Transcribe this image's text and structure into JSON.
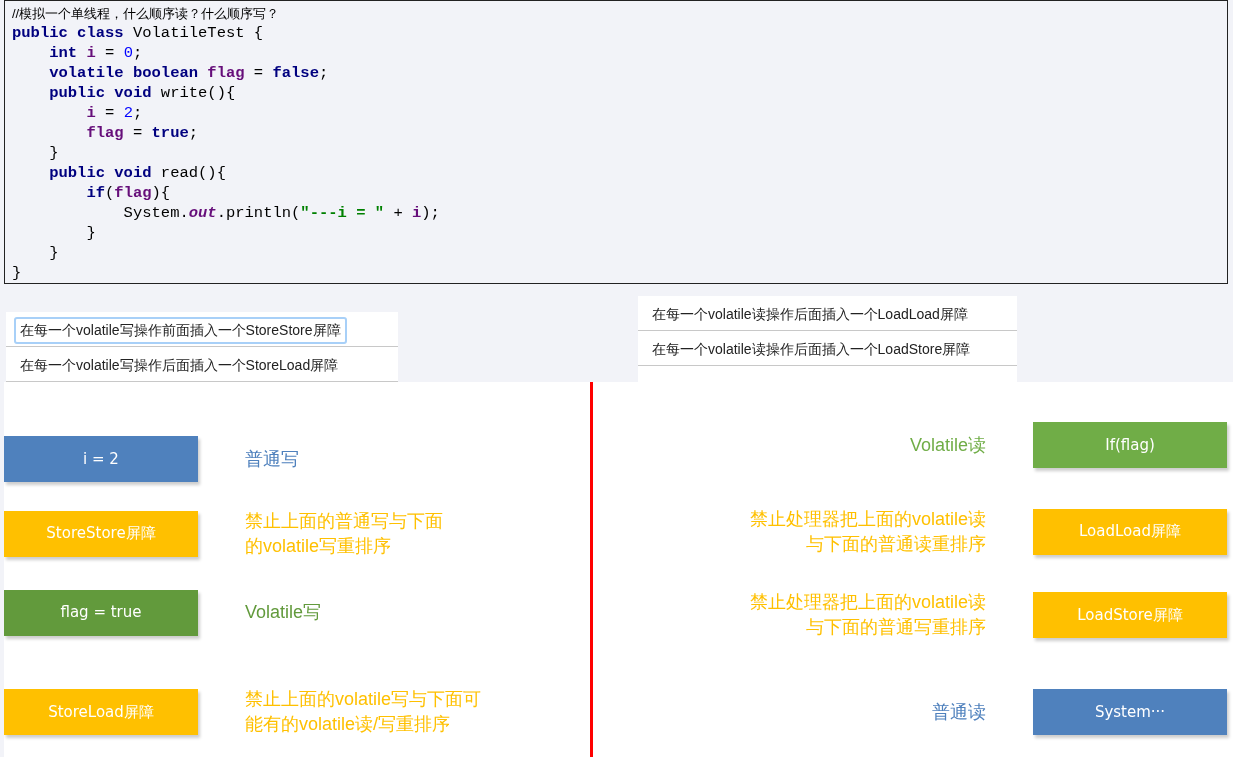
{
  "code": {
    "comment": "//模拟一个单线程，什么顺序读？什么顺序写？",
    "lines": [
      [
        {
          "kind": "keyword",
          "text": "public class"
        },
        {
          "kind": "plain",
          "text": " VolatileTest {"
        }
      ],
      [
        {
          "kind": "keyword",
          "text": "    int"
        },
        {
          "kind": "field",
          "text": " i"
        },
        {
          "kind": "plain",
          "text": " = "
        },
        {
          "kind": "number",
          "text": "0"
        },
        {
          "kind": "plain",
          "text": ";"
        }
      ],
      [
        {
          "kind": "keyword",
          "text": "    volatile boolean"
        },
        {
          "kind": "field",
          "text": " flag"
        },
        {
          "kind": "plain",
          "text": " = "
        },
        {
          "kind": "keyword",
          "text": "false"
        },
        {
          "kind": "plain",
          "text": ";"
        }
      ],
      [
        {
          "kind": "keyword",
          "text": "    public void"
        },
        {
          "kind": "plain",
          "text": " write(){"
        }
      ],
      [
        {
          "kind": "field",
          "text": "        i"
        },
        {
          "kind": "plain",
          "text": " = "
        },
        {
          "kind": "number",
          "text": "2"
        },
        {
          "kind": "plain",
          "text": ";"
        }
      ],
      [
        {
          "kind": "field",
          "text": "        flag"
        },
        {
          "kind": "plain",
          "text": " = "
        },
        {
          "kind": "keyword",
          "text": "true"
        },
        {
          "kind": "plain",
          "text": ";"
        }
      ],
      [
        {
          "kind": "plain",
          "text": "    }"
        }
      ],
      [
        {
          "kind": "keyword",
          "text": "    public void"
        },
        {
          "kind": "plain",
          "text": " read(){"
        }
      ],
      [
        {
          "kind": "keyword",
          "text": "        if"
        },
        {
          "kind": "plain",
          "text": "("
        },
        {
          "kind": "field",
          "text": "flag"
        },
        {
          "kind": "plain",
          "text": "){"
        }
      ],
      [
        {
          "kind": "plain",
          "text": "            System."
        },
        {
          "kind": "static",
          "text": "out"
        },
        {
          "kind": "plain",
          "text": ".println("
        },
        {
          "kind": "string",
          "text": "\"---i = \""
        },
        {
          "kind": "plain",
          "text": " + "
        },
        {
          "kind": "field",
          "text": "i"
        },
        {
          "kind": "plain",
          "text": ");"
        }
      ],
      [
        {
          "kind": "plain",
          "text": "        }"
        }
      ],
      [
        {
          "kind": "plain",
          "text": "    }"
        }
      ],
      [
        {
          "kind": "plain",
          "text": "}"
        }
      ]
    ]
  },
  "write_notes": [
    {
      "text": "在每一个volatile写操作前面插入一个StoreStore屏障",
      "highlighted": true
    },
    {
      "text": "在每一个volatile写操作后面插入一个StoreLoad屏障",
      "highlighted": false
    }
  ],
  "read_notes": [
    {
      "text": "在每一个volatile读操作后面插入一个LoadLoad屏障",
      "highlighted": false
    },
    {
      "text": "在每一个volatile读操作后面插入一个LoadStore屏障",
      "highlighted": false
    }
  ],
  "write_side": [
    {
      "box": "i = 2",
      "color": "#4f81bd",
      "caption": [
        "普通写"
      ]
    },
    {
      "box": "StoreStore屏障",
      "color": "#ffc000",
      "caption": [
        "禁止上面的普通写与下面",
        "的volatile写重排序"
      ]
    },
    {
      "box": "flag = true",
      "color": "#629a3c",
      "caption": [
        "Volatile写"
      ]
    },
    {
      "box": "StoreLoad屏障",
      "color": "#ffc000",
      "caption": [
        "禁止上面的volatile写与下面可",
        "能有的volatile读/写重排序"
      ]
    }
  ],
  "read_side": [
    {
      "box": "If(flag)",
      "color": "#70ad47",
      "caption": [
        "Volatile读"
      ]
    },
    {
      "box": "LoadLoad屏障",
      "color": "#ffc000",
      "caption": [
        "禁止处理器把上面的volatile读",
        "与下面的普通读重排序"
      ]
    },
    {
      "box": "LoadStore屏障",
      "color": "#ffc000",
      "caption": [
        "禁止处理器把上面的volatile读",
        "与下面的普通写重排序"
      ]
    },
    {
      "box": "System···",
      "color": "#4f81bd",
      "caption": [
        "普通读"
      ]
    }
  ]
}
